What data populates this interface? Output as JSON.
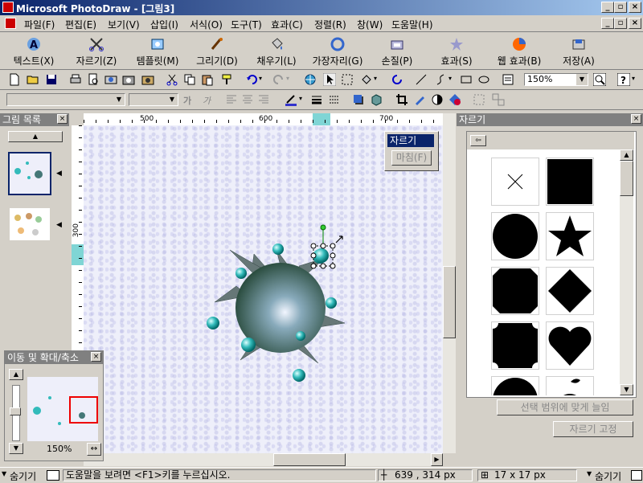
{
  "window": {
    "title": "Microsoft PhotoDraw - [그림3]"
  },
  "menu": [
    "파일(F)",
    "편집(E)",
    "보기(V)",
    "삽입(I)",
    "서식(O)",
    "도구(T)",
    "효과(C)",
    "정렬(R)",
    "창(W)",
    "도움말(H)"
  ],
  "big_toolbar": [
    "텍스트(X)",
    "자르기(Z)",
    "템플릿(M)",
    "그리기(D)",
    "채우기(L)",
    "가장자리(G)",
    "손질(P)",
    "효과(S)",
    "웹 효과(B)",
    "저장(A)"
  ],
  "zoom": "150%",
  "picture_list": {
    "title": "그림 목록"
  },
  "ruler": {
    "h": [
      "500",
      "600",
      "700"
    ],
    "v": [
      "300"
    ]
  },
  "crop_popup": {
    "crop": "자르기",
    "finish": "마침(F)"
  },
  "nav_panel": {
    "title": "이동 및 확대/축소",
    "zoom": "150%"
  },
  "crop_panel": {
    "title": "자르기",
    "fit_button": "선택 범위에 맞게 늘임",
    "lock_button": "자르기 고정"
  },
  "status": {
    "hide_left": "숨기기",
    "help": "도움말을 보려면 <F1>키를 누르십시오.",
    "coords": "639 , 314  px",
    "size": "17 x 17  px",
    "hide_right": "숨기기"
  }
}
